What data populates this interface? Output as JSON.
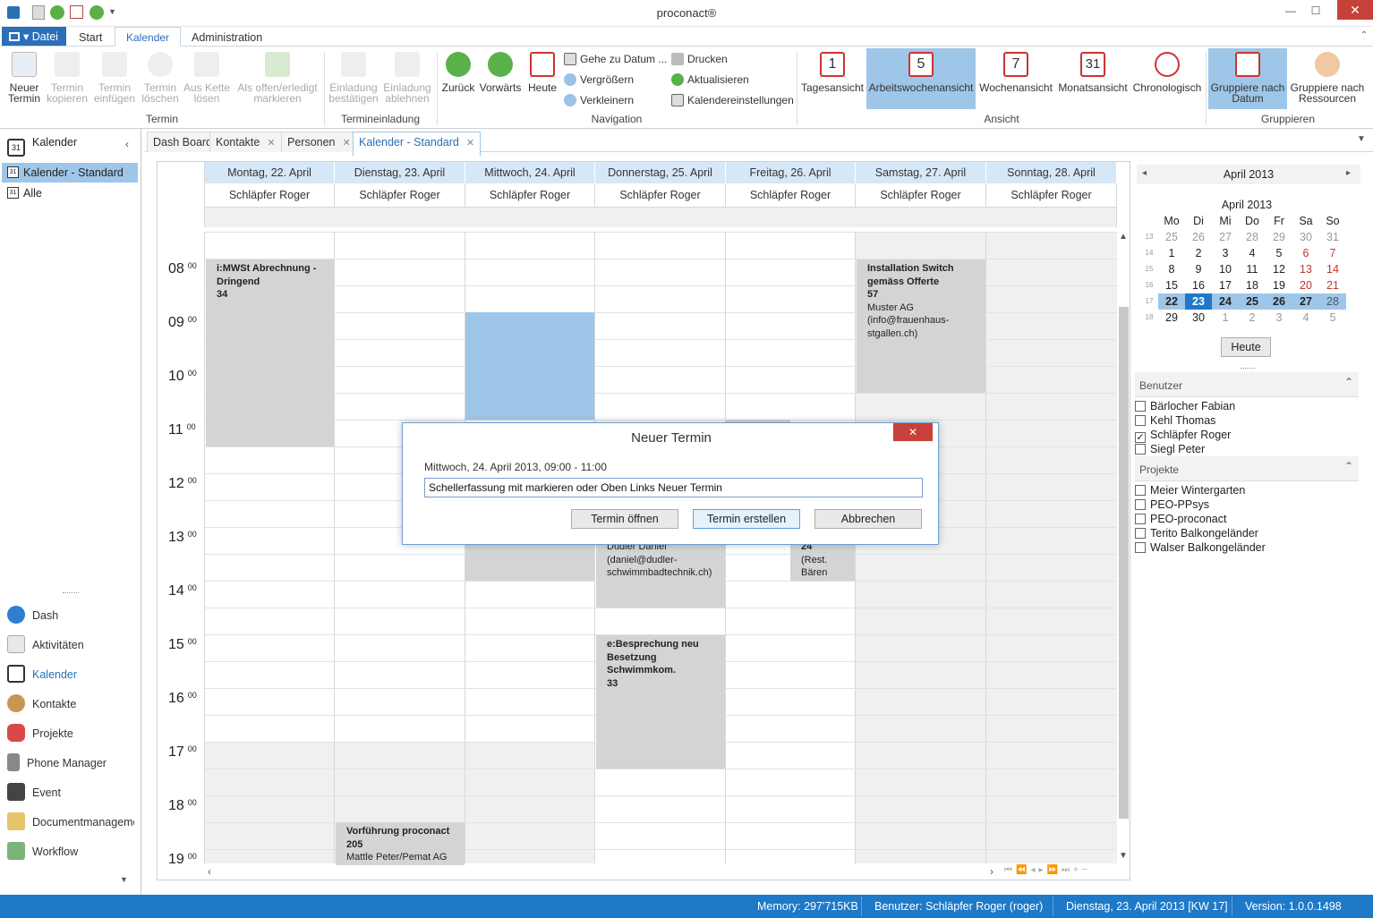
{
  "app": {
    "title": "proconact®"
  },
  "menu": {
    "datei": "Datei",
    "tabs": [
      "Start",
      "Kalender",
      "Administration"
    ]
  },
  "ribbon": {
    "termin": {
      "group": "Termin",
      "neuer": [
        "Neuer",
        "Termin"
      ],
      "kopieren": [
        "Termin",
        "kopieren"
      ],
      "einfuegen": [
        "Termin",
        "einfügen"
      ],
      "loeschen": [
        "Termin",
        "löschen"
      ],
      "kette": [
        "Aus Kette",
        "lösen"
      ],
      "offen": [
        "Als offen/erledigt",
        "markieren"
      ]
    },
    "einladung": {
      "group": "Termineinladung",
      "bestaetigen": [
        "Einladung",
        "bestätigen"
      ],
      "ablehnen": [
        "Einladung",
        "ablehnen"
      ]
    },
    "navigation": {
      "group": "Navigation",
      "zurueck": "Zurück",
      "vorwaerts": "Vorwärts",
      "heute": "Heute",
      "gehe": "Gehe zu Datum ...",
      "vergroessern": "Vergrößern",
      "verkleinern": "Verkleinern",
      "drucken": "Drucken",
      "aktualisieren": "Aktualisieren",
      "einstellungen": "Kalendereinstellungen"
    },
    "ansicht": {
      "group": "Ansicht",
      "tages": "Tagesansicht",
      "tages_num": "1",
      "arbeit": "Arbeitswochenansicht",
      "arbeit_num": "5",
      "woche": "Wochenansicht",
      "woche_num": "7",
      "monat": "Monatsansicht",
      "monat_num": "31",
      "chrono": "Chronologisch"
    },
    "gruppieren": {
      "group": "Gruppieren",
      "datum": [
        "Gruppiere nach",
        "Datum"
      ],
      "ressourcen": [
        "Gruppiere nach",
        "Ressourcen"
      ]
    }
  },
  "leftpane": {
    "header": "Kalender",
    "items": [
      "Kalender - Standard",
      "Alle"
    ],
    "nav": [
      "Dash",
      "Aktivitäten",
      "Kalender",
      "Kontakte",
      "Projekte",
      "Phone Manager",
      "Event",
      "Documentmanagemen",
      "Workflow"
    ]
  },
  "doctabs": [
    "Dash Board",
    "Kontakte",
    "Personen",
    "Kalender - Standard"
  ],
  "calendar": {
    "days": [
      "Montag, 22. April",
      "Dienstag, 23. April",
      "Mittwoch, 24. April",
      "Donnerstag, 25. April",
      "Freitag, 26. April",
      "Samstag, 27. April",
      "Sonntag, 28. April"
    ],
    "resource": "Schläpfer Roger",
    "hours": [
      "08",
      "09",
      "10",
      "11",
      "12",
      "13",
      "14",
      "15",
      "16",
      "17",
      "18",
      "19"
    ],
    "minutes": "00",
    "appointments": {
      "mwst": {
        "title": "i:MWSt Abrechnung - Dringend",
        "num": "34"
      },
      "switch": {
        "title": "Installation Switch gemäss Offerte",
        "num": "57",
        "body": "Muster AG (info@frauenhaus-stgallen.ch)"
      },
      "dudler": {
        "body": "Dudler Daniel (daniel@dudler-schwimmbadtechnik.ch)"
      },
      "baeren": {
        "num": "24",
        "body": "(Rest. Bären Kreuzlingen"
      },
      "besprechung": {
        "title": "e:Besprechung neu Besetzung Schwimmkom.",
        "num": "33"
      },
      "vorfuehrung": {
        "title": "Vorführung proconact",
        "num": "205",
        "body": "Mattle Peter/Pemat AG"
      }
    }
  },
  "dialog": {
    "title": "Neuer Termin",
    "datetime": "Mittwoch, 24. April 2013, 09:00 - 11:00",
    "input_value": "Schellerfassung mit markieren oder Oben Links Neuer Termin",
    "btn_open": "Termin öffnen",
    "btn_create": "Termin erstellen",
    "btn_cancel": "Abbrechen"
  },
  "minical": {
    "header": "April 2013",
    "title": "April 2013",
    "dow": [
      "Mo",
      "Di",
      "Mi",
      "Do",
      "Fr",
      "Sa",
      "So"
    ],
    "weeks": [
      {
        "wk": "13",
        "days": [
          "25",
          "26",
          "27",
          "28",
          "29",
          "30",
          "31"
        ]
      },
      {
        "wk": "14",
        "days": [
          "1",
          "2",
          "3",
          "4",
          "5",
          "6",
          "7"
        ]
      },
      {
        "wk": "15",
        "days": [
          "8",
          "9",
          "10",
          "11",
          "12",
          "13",
          "14"
        ]
      },
      {
        "wk": "16",
        "days": [
          "15",
          "16",
          "17",
          "18",
          "19",
          "20",
          "21"
        ]
      },
      {
        "wk": "17",
        "days": [
          "22",
          "23",
          "24",
          "25",
          "26",
          "27",
          "28"
        ]
      },
      {
        "wk": "18",
        "days": [
          "29",
          "30",
          "1",
          "2",
          "3",
          "4",
          "5"
        ]
      }
    ],
    "today_btn": "Heute"
  },
  "benutzer": {
    "header": "Benutzer",
    "items": [
      {
        "label": "Bärlocher Fabian",
        "checked": false
      },
      {
        "label": "Kehl Thomas",
        "checked": false
      },
      {
        "label": "Schläpfer Roger",
        "checked": true
      },
      {
        "label": "Siegl Peter",
        "checked": false
      }
    ]
  },
  "projekte": {
    "header": "Projekte",
    "items": [
      "Meier Wintergarten",
      "PEO-PPsys",
      "PEO-proconact",
      "Terito Balkongeländer",
      "Walser Balkongeländer"
    ]
  },
  "status": {
    "memory": "Memory: 297'715KB",
    "user": "Benutzer: Schläpfer Roger (roger)",
    "date": "Dienstag, 23. April 2013 [KW 17]",
    "version": "Version: 1.0.0.1498"
  },
  "colors": {
    "accent": "#1e79c8",
    "highlight": "#9ec6e8",
    "appointment": "#d4d4d4",
    "weekend_red": "#c0392b"
  }
}
